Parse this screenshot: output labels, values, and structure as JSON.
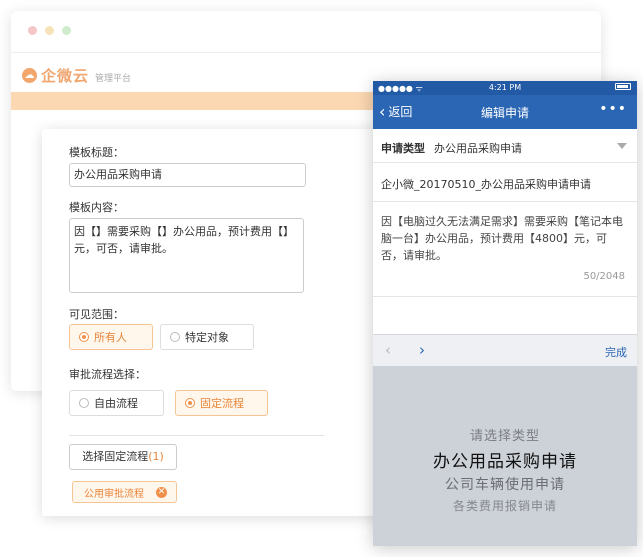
{
  "app": {
    "logo_text": "企微云",
    "platform_label": "管理平台"
  },
  "form": {
    "title_label": "模板标题：",
    "title_value": "办公用品采购申请",
    "content_label": "模板内容：",
    "content_value": "因【】需要采购【】办公用品，预计费用【】元，可否，请审批。",
    "visibility_label": "可见范围：",
    "visibility_options": [
      "所有人",
      "特定对象"
    ],
    "visibility_selected": "所有人",
    "flow_label": "审批流程选择：",
    "flow_options": [
      "自由流程",
      "固定流程"
    ],
    "flow_selected": "固定流程",
    "choose_flow_label": "选择固定流程",
    "choose_flow_count": "(1)",
    "selected_flow_tag": "公用审批流程"
  },
  "phone": {
    "status": {
      "carrier": "●●●●● ᯤ",
      "time": "4:21 PM"
    },
    "nav": {
      "back_label": "返回",
      "title": "编辑申请",
      "more": "•••"
    },
    "type_key": "申请类型",
    "type_value": "办公用品采购申请",
    "request_title": "企小微_20170510_办公用品采购申请申请",
    "request_content": "因【电脑过久无法满足需求】需要采购【笔记本电脑一台】办公用品，预计费用【4800】元，可否，请审批。",
    "char_count": "50/2048",
    "toolbar": {
      "prev": "‹",
      "next": "›",
      "done": "完成"
    },
    "picker_options": [
      "请选择类型",
      "办公用品采购申请",
      "公司车辆使用申请",
      "各类费用报销申请"
    ]
  }
}
